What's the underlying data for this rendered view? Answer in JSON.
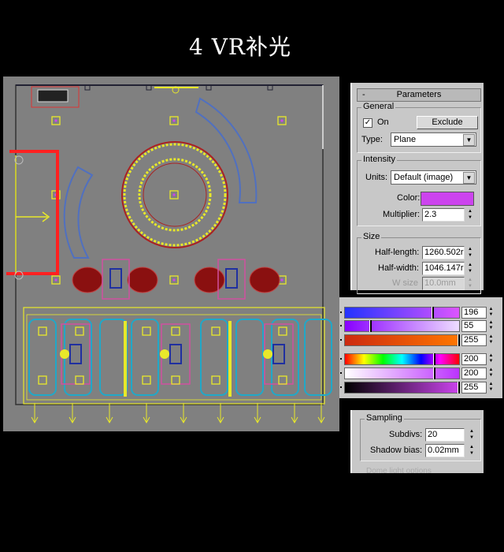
{
  "title": "4 VR补光",
  "colors": {
    "light_color": "#cc44ee",
    "light_line": "#e8e82a",
    "selection": "#ff2020",
    "viewport_bg": "#808080"
  },
  "params": {
    "rollout_minus": "-",
    "rollout_title": "Parameters",
    "general": {
      "title": "General",
      "on_label": "On",
      "on_checked": true,
      "check_mark": "✓",
      "exclude_label": "Exclude",
      "type_label": "Type:",
      "type_value": "Plane"
    },
    "intensity": {
      "title": "Intensity",
      "units_label": "Units:",
      "units_value": "Default (image)",
      "color_label": "Color:",
      "multiplier_label": "Multiplier:",
      "multiplier_value": "2.3"
    },
    "size": {
      "title": "Size",
      "half_length_label": "Half-length:",
      "half_length_value": "1260.502r",
      "half_width_label": "Half-width:",
      "half_width_value": "1046.147r",
      "w_size_label": "W size",
      "w_size_value": "10.0mm"
    }
  },
  "color_selector": {
    "rows": [
      {
        "value": "196",
        "fraction": 0.77
      },
      {
        "value": "55",
        "fraction": 0.22
      },
      {
        "value": "255",
        "fraction": 1.0
      },
      {
        "value": "200",
        "fraction": 0.78
      },
      {
        "value": "200",
        "fraction": 0.78
      },
      {
        "value": "255",
        "fraction": 1.0
      }
    ]
  },
  "sampling": {
    "title": "Sampling",
    "subdivs_label": "Subdivs:",
    "subdivs_value": "20",
    "shadow_bias_label": "Shadow bias:",
    "shadow_bias_value": "0.02mm",
    "next_group_label": "Dome light options"
  },
  "icons": {
    "spinner_up": "▲",
    "spinner_down": "▼",
    "dropdown": "▼"
  }
}
